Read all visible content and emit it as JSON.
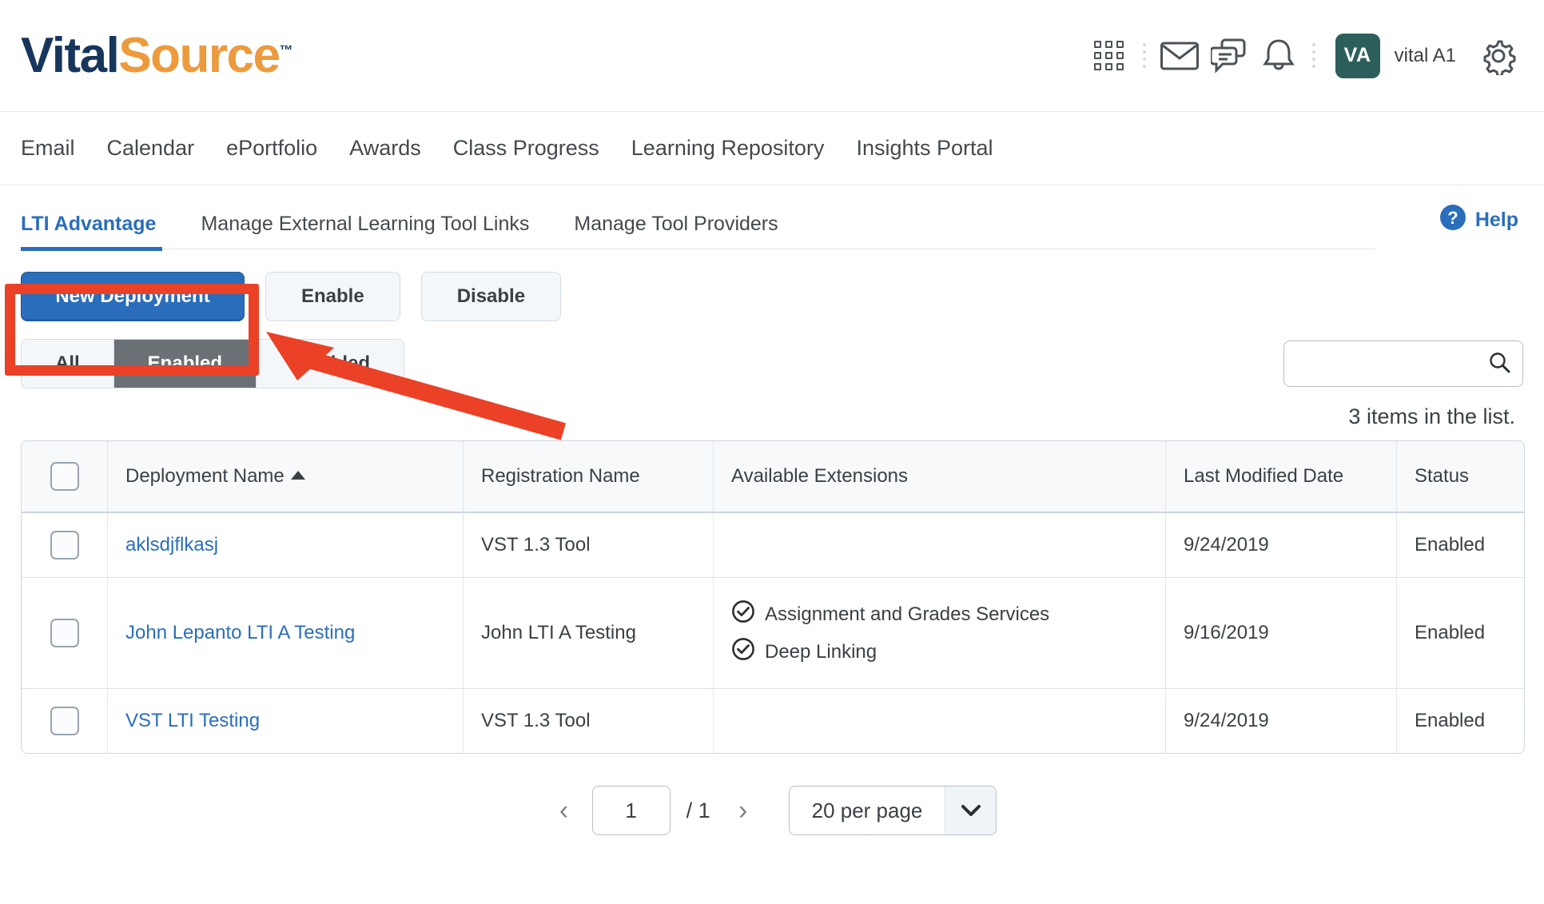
{
  "brand": {
    "name_part1": "Vital",
    "name_part2": "Source",
    "trademark": "™",
    "color_navy": "#17365c",
    "color_orange": "#ed9a3d"
  },
  "header": {
    "icons": [
      "apps-grid-icon",
      "email-icon",
      "chat-icon",
      "bell-icon"
    ],
    "avatar_initials": "VA",
    "avatar_color": "#2d5f5a",
    "username": "vital A1",
    "settings_icon": "gear-icon"
  },
  "nav": {
    "items": [
      {
        "label": "Email"
      },
      {
        "label": "Calendar"
      },
      {
        "label": "ePortfolio"
      },
      {
        "label": "Awards"
      },
      {
        "label": "Class Progress"
      },
      {
        "label": "Learning Repository"
      },
      {
        "label": "Insights Portal"
      }
    ]
  },
  "tabs": {
    "items": [
      {
        "label": "LTI Advantage",
        "active": true
      },
      {
        "label": "Manage External Learning Tool Links",
        "active": false
      },
      {
        "label": "Manage Tool Providers",
        "active": false
      }
    ],
    "help_label": "Help",
    "accent_color": "#2a6ebb"
  },
  "toolbar": {
    "new_deployment_label": "New Deployment",
    "enable_label": "Enable",
    "disable_label": "Disable"
  },
  "filters": {
    "items": [
      {
        "label": "All",
        "active": false
      },
      {
        "label": "Enabled",
        "active": true
      },
      {
        "label": "Disabled",
        "active": false
      }
    ]
  },
  "search": {
    "value": "",
    "placeholder": "",
    "icon": "search-icon"
  },
  "list": {
    "items_count_text": "3 items in the list.",
    "columns": [
      {
        "key": "select",
        "label": ""
      },
      {
        "key": "name",
        "label": "Deployment Name",
        "sorted": "asc"
      },
      {
        "key": "registration",
        "label": "Registration Name"
      },
      {
        "key": "extensions",
        "label": "Available Extensions"
      },
      {
        "key": "modified",
        "label": "Last Modified Date"
      },
      {
        "key": "status",
        "label": "Status"
      }
    ],
    "rows": [
      {
        "name": "aklsdjflkasj",
        "registration": "VST 1.3 Tool",
        "extensions": [],
        "modified": "9/24/2019",
        "status": "Enabled"
      },
      {
        "name": "John Lepanto LTI A Testing",
        "registration": "John LTI A Testing",
        "extensions": [
          "Assignment and Grades Services",
          "Deep Linking"
        ],
        "modified": "9/16/2019",
        "status": "Enabled"
      },
      {
        "name": "VST LTI Testing",
        "registration": "VST 1.3 Tool",
        "extensions": [],
        "modified": "9/24/2019",
        "status": "Enabled"
      }
    ]
  },
  "pagination": {
    "prev_icon": "chevron-left-icon",
    "next_icon": "chevron-right-icon",
    "current_page": "1",
    "total_pages_label": "/ 1",
    "per_page_label": "20 per page",
    "caret_icon": "chevron-down-icon"
  },
  "annotations": {
    "highlight_color": "#ea4127",
    "highlight_target": "New Deployment",
    "arrow_points_to": "New Deployment"
  }
}
